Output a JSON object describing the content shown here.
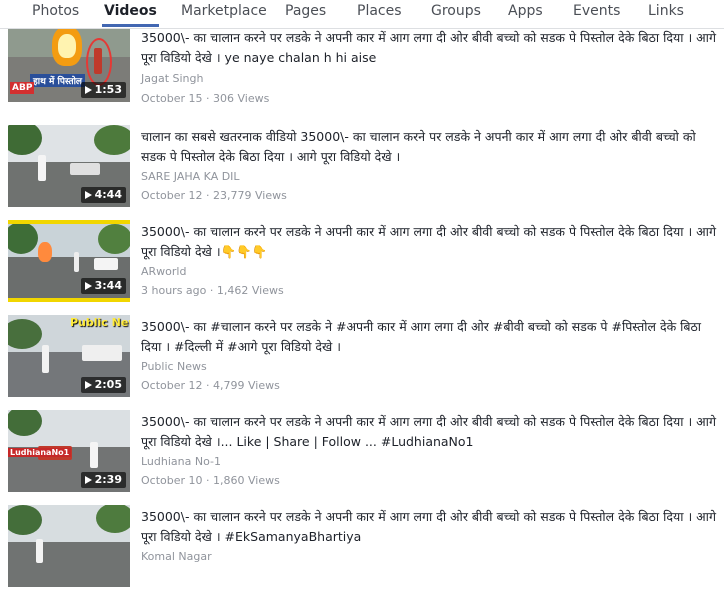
{
  "tabs": [
    {
      "label": "Photos",
      "active": false
    },
    {
      "label": "Videos",
      "active": true
    },
    {
      "label": "Marketplace",
      "active": false
    },
    {
      "label": "Pages",
      "active": false
    },
    {
      "label": "Places",
      "active": false
    },
    {
      "label": "Groups",
      "active": false
    },
    {
      "label": "Apps",
      "active": false
    },
    {
      "label": "Events",
      "active": false
    },
    {
      "label": "Links",
      "active": false
    }
  ],
  "videos": [
    {
      "title": "35000\\- का चालान करने पर लडके ने अपनी कार में आग लगा दी ओर बीवी बच्चो को सडक पे पिस्तोल देके बिठा दिया । आगे पूरा विडियो देखे । ye naye chalan h hi aise",
      "author": "Jagat Singh",
      "date": "October 15",
      "views": "306 Views",
      "duration": "1:53",
      "thumb_caption": "हाथ में पिस्तोल"
    },
    {
      "title": "चालान का सबसे खतरनाक वीडियो 35000\\- का चालान करने पर लडके ने अपनी कार में आग लगा दी ओर बीवी बच्चो को सडक पे पिस्तोल देके बिठा दिया । आगे पूरा विडियो देखे ।",
      "author": "SARE JAHA KA DIL",
      "date": "October 12",
      "views": "23,779 Views",
      "duration": "4:44"
    },
    {
      "title": "35000\\- का चालान करने पर लडके ने अपनी कार में आग लगा दी ओर बीवी बच्चो को सडक पे पिस्तोल देके बिठा दिया । आगे पूरा विडियो देखे ।👇👇👇",
      "author": "ARworld",
      "date": "3 hours ago",
      "views": "1,462 Views",
      "duration": "3:44"
    },
    {
      "title": "35000\\- का #चालान करने पर लडके ने #अपनी कार में आग लगा दी ओर #बीवी बच्चो को सडक पे #पिस्तोल देके बिठा दिया । #दिल्ली में #आगे पूरा विडियो देखे ।",
      "author": "Public News",
      "date": "October 12",
      "views": "4,799 Views",
      "duration": "2:05",
      "thumb_caption": "Public News"
    },
    {
      "title": "35000\\- का चालान करने पर लडके ने अपनी कार में आग लगा दी ओर बीवी बच्चो को सडक पे पिस्तोल देके बिठा दिया । आगे पूरा विडियो देखे ।... Like | Share | Follow ... #LudhianaNo1",
      "author": "Ludhiana No-1",
      "date": "October 10",
      "views": "1,860 Views",
      "duration": "2:39",
      "thumb_caption": "LudhianaNo1"
    },
    {
      "title": "35000\\- का चालान करने पर लडके ने अपनी कार में आग लगा दी ओर बीवी बच्चो को सडक पे पिस्तोल देके बिठा दिया । आगे पूरा विडियो देखे । #EkSamanyaBhartiya",
      "author": "Komal Nagar"
    }
  ],
  "meta_separator": " · ",
  "thumb_badge": "ABP",
  "colors": {
    "accent": "#4267b2",
    "meta": "#90949c",
    "text": "#1d2129"
  }
}
